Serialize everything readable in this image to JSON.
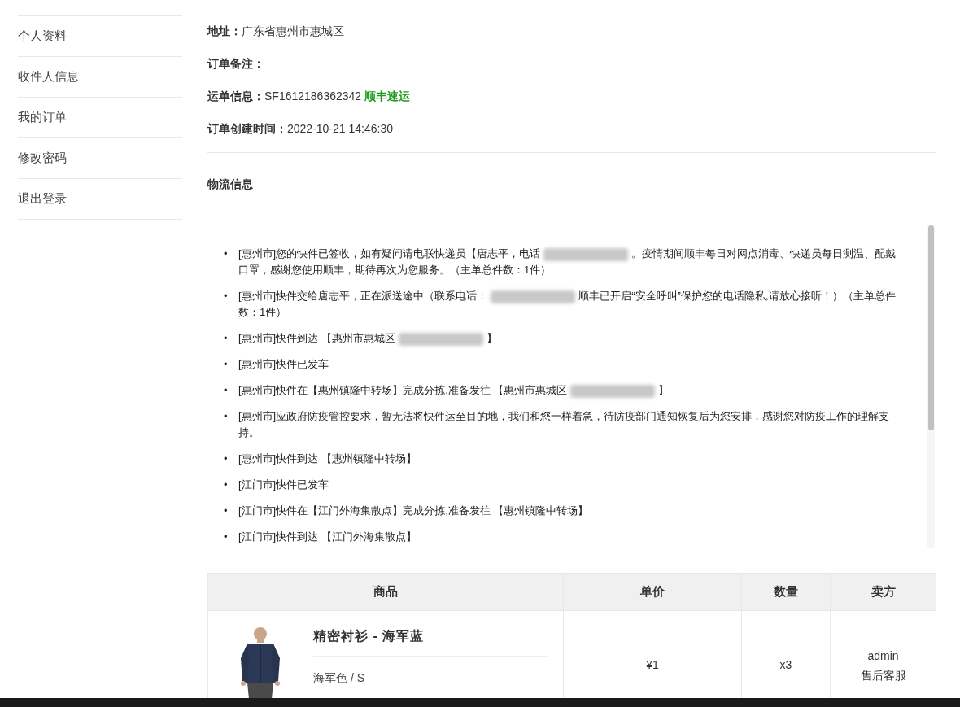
{
  "sidebar": {
    "items": [
      {
        "label": "个人资料"
      },
      {
        "label": "收件人信息"
      },
      {
        "label": "我的订单"
      },
      {
        "label": "修改密码"
      },
      {
        "label": "退出登录"
      }
    ]
  },
  "order_info": [
    {
      "label": "地址：",
      "value": "广东省惠州市惠城区"
    },
    {
      "label": "订单备注："
    },
    {
      "label": "运单信息：",
      "value": "SF1612186362342",
      "carrier": "顺丰速运"
    },
    {
      "label": "订单创建时间：",
      "value": "2022-10-21 14:46:30"
    }
  ],
  "logistics": {
    "title": "物流信息",
    "items": [
      {
        "bullet": "•",
        "before": "[惠州市]您的快件已签收，如有疑问请电联快递员【唐志平，电话",
        "redacted": true,
        "after": "。疫情期间顺丰每日对网点消毒、快递员每日测温、配戴口罩，感谢您使用顺丰，期待再次为您服务。（主单总件数：1件）"
      },
      {
        "bullet": "•",
        "before": "[惠州市]快件交给唐志平，正在派送途中（联系电话：",
        "redacted": true,
        "after": "顺丰已开启“安全呼叫”保护您的电话隐私,请放心接听！）（主单总件数：1件）"
      },
      {
        "bullet": "•",
        "before": "[惠州市]快件到达 【惠州市惠城区",
        "redacted": true,
        "after": "】"
      },
      {
        "bullet": "•",
        "before": "[惠州市]快件已发车",
        "redacted": false
      },
      {
        "bullet": "•",
        "before": "[惠州市]快件在【惠州镇隆中转场】完成分拣,准备发往 【惠州市惠城区",
        "redacted": true,
        "after": "】"
      },
      {
        "bullet": "•",
        "before": "[惠州市]应政府防疫管控要求，暂无法将快件运至目的地，我们和您一样着急，待防疫部门通知恢复后为您安排，感谢您对防疫工作的理解支持。",
        "redacted": false
      },
      {
        "bullet": "•",
        "before": "[惠州市]快件到达 【惠州镇隆中转场】",
        "redacted": false
      },
      {
        "bullet": "•",
        "before": "[江门市]快件已发车",
        "redacted": false
      },
      {
        "bullet": "•",
        "before": "[江门市]快件在【江门外海集散点】完成分拣,准备发往 【惠州镇隆中转场】",
        "redacted": false
      },
      {
        "bullet": "•",
        "before": "[江门市]快件到达 【江门外海集散点】",
        "redacted": false
      }
    ]
  },
  "table": {
    "columns": [
      "商品",
      "单价",
      "数量",
      "卖方"
    ],
    "rows": [
      {
        "product": {
          "kind": "picture",
          "name": "精密衬衫 - 海军蓝",
          "variant": "海军色 / S"
        },
        "price": "¥1",
        "quantity": "x3",
        "seller": "admin",
        "seller_link": "售后客服"
      }
    ]
  }
}
